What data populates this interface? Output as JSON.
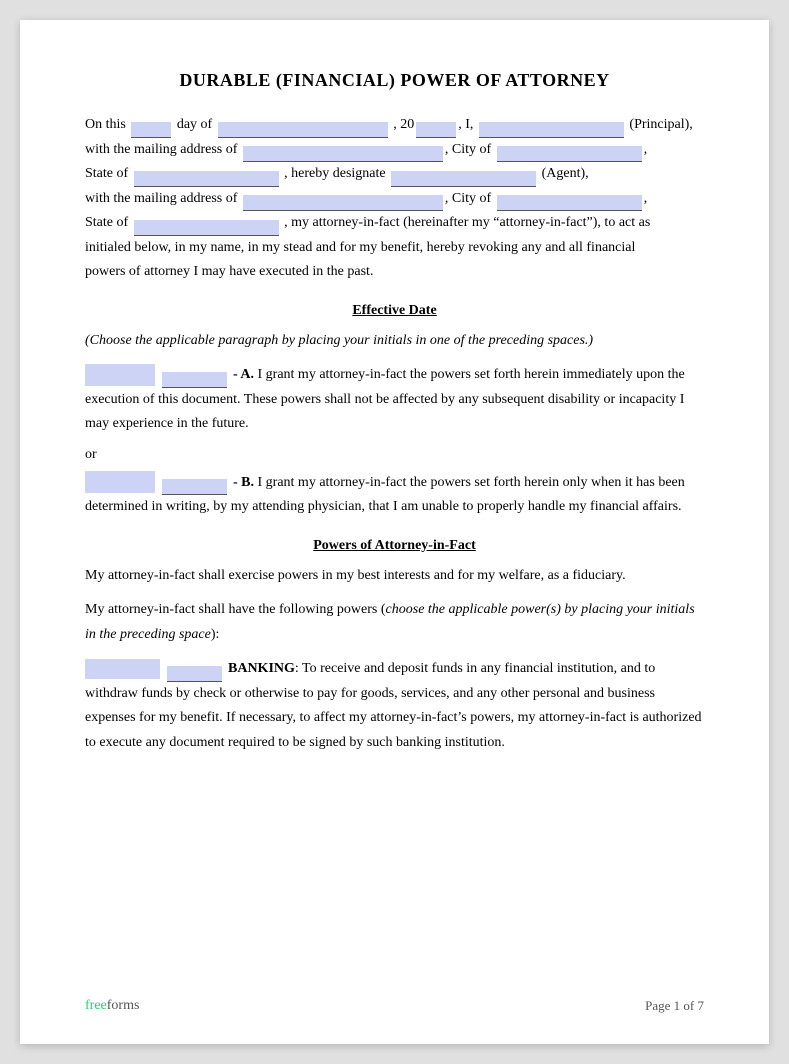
{
  "document": {
    "title": "DURABLE (FINANCIAL) POWER OF ATTORNEY",
    "intro": {
      "line1_pre": "On this",
      "line1_day": "",
      "line1_dayof": "day of",
      "line1_month": "",
      "line1_year": ", 20",
      "line1_year_val": "",
      "line1_i": ", I,",
      "line1_principal": "",
      "line1_principal_suffix": "(Principal),",
      "line2_pre": "with the mailing address of",
      "line2_address": "",
      "line2_city_pre": ", City of",
      "line2_city": "",
      "line3_pre": "State of",
      "line3_state": "",
      "line3_designate": ", hereby designate",
      "line3_agent": "",
      "line3_agent_suffix": "(Agent),",
      "line4_pre": "with the mailing address of",
      "line4_address": "",
      "line4_city_pre": ", City of",
      "line4_city": "",
      "line5_pre": "State of",
      "line5_state": "",
      "line5_suffix": ", my attorney-in-fact (hereinafter my “attorney-in-fact”), to act as",
      "line6": "initialed below, in my name, in my stead and for my benefit, hereby revoking any and all financial",
      "line7": "powers of attorney I may have executed in the past."
    },
    "effective_date": {
      "heading": "Effective Date",
      "instruction": "(Choose the applicable paragraph by placing your initials in one of the preceding spaces.)",
      "option_a_label": "- A.",
      "option_a_text": "I grant my attorney-in-fact the powers set forth herein immediately upon the execution of this document. These powers shall not be affected by any subsequent disability or incapacity I may experience in the future.",
      "or_text": "or",
      "option_b_label": "- B.",
      "option_b_text": "I grant my attorney-in-fact the powers set forth herein only when it has been determined in writing, by my attending physician, that I am unable to properly handle my financial affairs."
    },
    "powers_section": {
      "heading": "Powers of Attorney-in-Fact",
      "para1": "My attorney-in-fact shall exercise powers in my best interests and for my welfare, as a fiduciary.",
      "para2_pre": "My attorney-in-fact shall have the following powers (",
      "para2_italic": "choose the applicable power(s) by placing your initials in the preceding space",
      "para2_post": "):",
      "banking_label": "BANKING",
      "banking_text": ": To receive and deposit funds in any financial institution, and to withdraw funds by check or otherwise to pay for goods, services, and any other personal and business expenses for my benefit.  If necessary, to affect my attorney-in-fact’s powers, my attorney-in-fact is authorized to execute any document required to be signed by such banking institution."
    },
    "footer": {
      "brand_free": "free",
      "brand_forms": "forms",
      "page_label": "Page 1 of 7"
    }
  }
}
